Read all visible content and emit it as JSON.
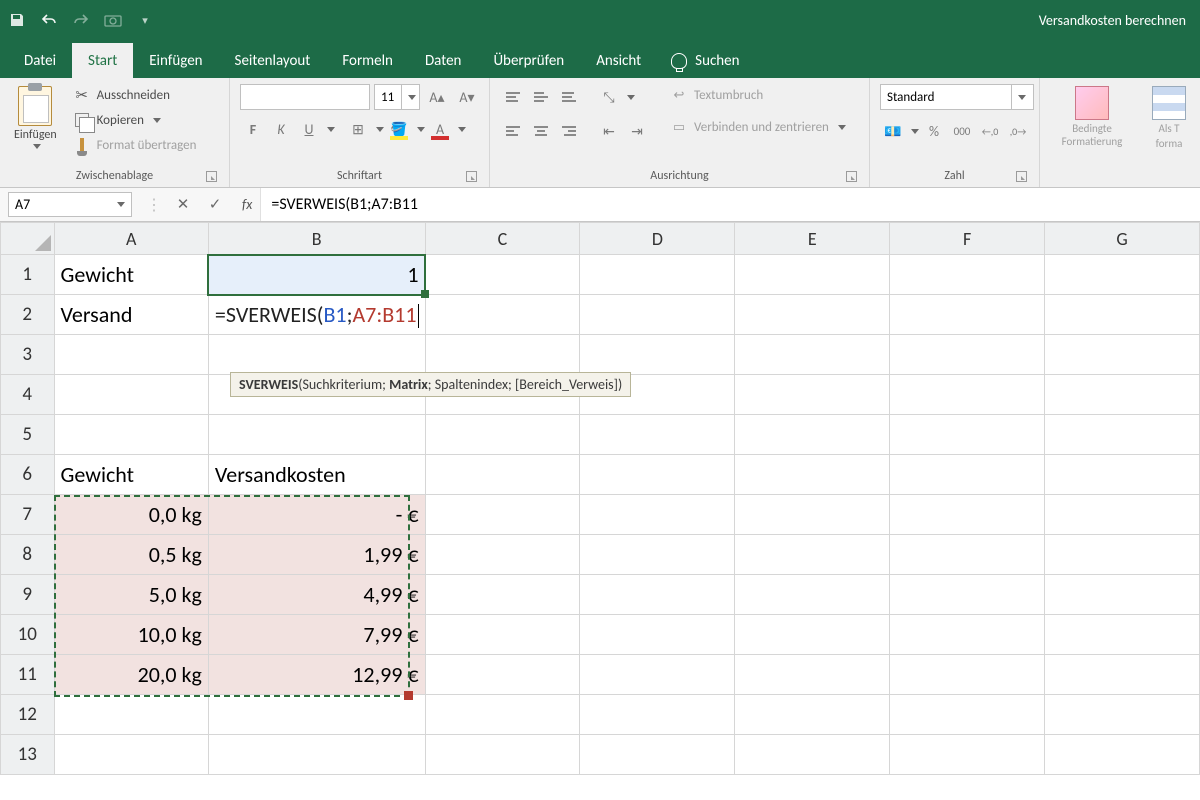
{
  "titlebar": {
    "title": "Versandkosten berechnen"
  },
  "tabs": {
    "file": "Datei",
    "home": "Start",
    "insert": "Einfügen",
    "layout": "Seitenlayout",
    "formulas": "Formeln",
    "data": "Daten",
    "review": "Überprüfen",
    "view": "Ansicht",
    "search": "Suchen"
  },
  "ribbon": {
    "clipboard": {
      "paste": "Einfügen",
      "cut": "Ausschneiden",
      "copy": "Kopieren",
      "painter": "Format übertragen",
      "label": "Zwischenablage"
    },
    "font": {
      "size": "11",
      "label": "Schriftart"
    },
    "align": {
      "wrap": "Textumbruch",
      "merge": "Verbinden und zentrieren",
      "label": "Ausrichtung"
    },
    "number": {
      "format": "Standard",
      "label": "Zahl"
    },
    "styles": {
      "cond": "Bedingte Formatierung",
      "astable": "Als T",
      "astable2": "forma"
    }
  },
  "namebox": "A7",
  "formula": {
    "prefix": "=SVERWEIS(",
    "arg1": "B1",
    "sep": ";",
    "arg2": "A7:B11"
  },
  "tooltip": {
    "fn": "SVERWEIS",
    "p1": "Suchkriterium",
    "p2": "Matrix",
    "p3": "Spaltenindex",
    "p4": "[Bereich_Verweis]"
  },
  "columns": [
    "A",
    "B",
    "C",
    "D",
    "E",
    "F",
    "G"
  ],
  "rows": {
    "1": {
      "A": "Gewicht",
      "B": "1"
    },
    "2": {
      "A": "Versand"
    },
    "6": {
      "A": "Gewicht",
      "B": "Versandkosten"
    },
    "7": {
      "A": "0,0 kg",
      "B": "-    €"
    },
    "8": {
      "A": "0,5 kg",
      "B": "1,99 €"
    },
    "9": {
      "A": "5,0 kg",
      "B": "4,99 €"
    },
    "10": {
      "A": "10,0 kg",
      "B": "7,99 €"
    },
    "11": {
      "A": "20,0 kg",
      "B": "12,99 €"
    }
  }
}
